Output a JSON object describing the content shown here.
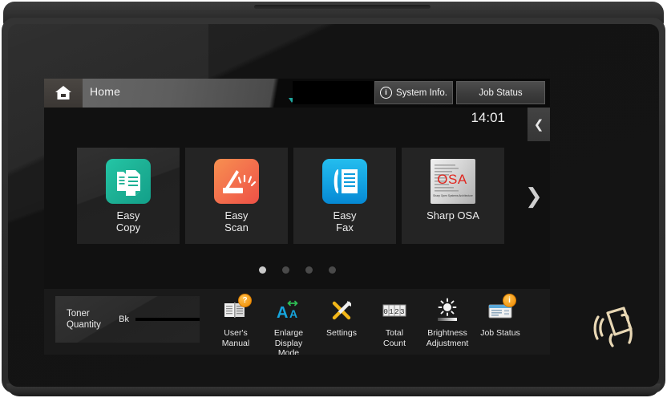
{
  "device": {
    "name": "multifunction-printer-touch-panel"
  },
  "header": {
    "home_icon": "home-icon",
    "home_label": "Home",
    "display_field_value": "",
    "system_info_label": "System Info.",
    "system_info_icon": "info-circle-icon",
    "job_status_label": "Job Status",
    "clock": "14:01",
    "collapse_icon": "chevron-left-icon"
  },
  "tiles": [
    {
      "label_line1": "Easy",
      "label_line2": "Copy",
      "icon": "copy-documents-icon",
      "color_start": "#1fbfa0",
      "color_end": "#19a98c"
    },
    {
      "label_line1": "Easy",
      "label_line2": "Scan",
      "icon": "scanner-icon",
      "color_start": "#f58a4b",
      "color_end": "#ef5a48"
    },
    {
      "label_line1": "Easy",
      "label_line2": "Fax",
      "icon": "fax-phone-document-icon",
      "color_start": "#1fb6e8",
      "color_end": "#0a8fd8"
    },
    {
      "label_line1": "Sharp OSA",
      "label_line2": "",
      "icon": "sharp-osa-icon",
      "osa_text": "OSA",
      "osa_tagline": "Sharp Open Systems Architecture",
      "color_start": "#e9e9e9",
      "color_end": "#a8a8a8"
    }
  ],
  "next_page_icon": "chevron-right-icon",
  "pagination": {
    "total": 4,
    "active": 1
  },
  "toner": {
    "title_line1": "Toner",
    "title_line2": "Quantity",
    "color_label": "Bk",
    "level_percent": 100
  },
  "tools": [
    {
      "label_line1": "User's",
      "label_line2": "Manual",
      "label_line3": "",
      "icon": "manual-book-icon",
      "badge": "?"
    },
    {
      "label_line1": "Enlarge",
      "label_line2": "Display",
      "label_line3": "Mode",
      "icon": "enlarge-text-icon",
      "badge": ""
    },
    {
      "label_line1": "Settings",
      "label_line2": "",
      "label_line3": "",
      "icon": "tools-wrench-screwdriver-icon",
      "badge": ""
    },
    {
      "label_line1": "Total",
      "label_line2": "Count",
      "label_line3": "",
      "icon": "counter-icon",
      "counter_text": "0123",
      "badge": ""
    },
    {
      "label_line1": "Brightness",
      "label_line2": "Adjustment",
      "label_line3": "",
      "icon": "brightness-sun-icon",
      "badge": ""
    },
    {
      "label_line1": "Job Status",
      "label_line2": "",
      "label_line3": "",
      "icon": "job-window-icon",
      "badge": "i"
    }
  ],
  "nfc": {
    "icon": "nfc-card-tap-icon",
    "color": "#e8d7b4"
  },
  "colors": {
    "screen_bg": "#111111",
    "accent_teal": "#1fa8a0",
    "badge_orange": "#f08a00",
    "text_primary": "#f0f0f0"
  }
}
